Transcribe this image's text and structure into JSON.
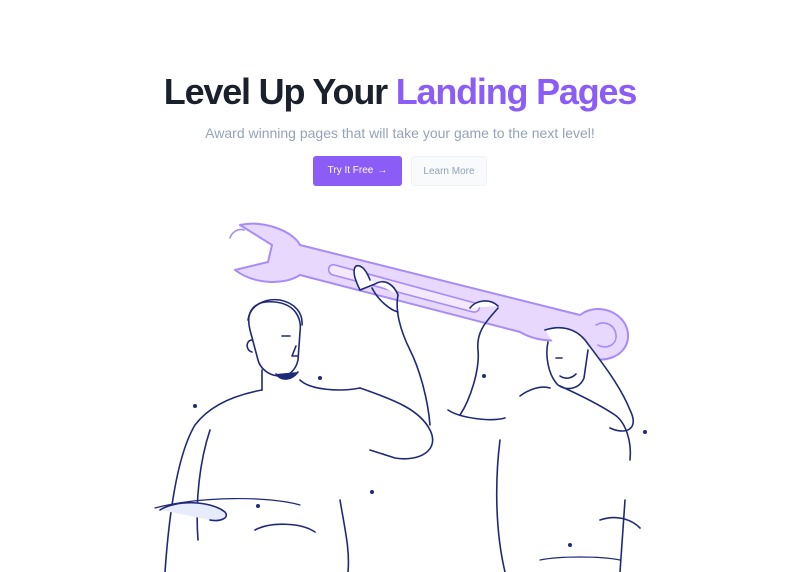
{
  "hero": {
    "title_dark": "Level Up Your ",
    "title_accent": "Landing Pages",
    "subtitle": "Award winning pages that will take your game to the next level!"
  },
  "buttons": {
    "primary_label": "Try It Free",
    "primary_icon": "→",
    "secondary_label": "Learn More"
  },
  "colors": {
    "accent": "#8b5cf6",
    "heading": "#1a202c",
    "muted": "#94a3b8",
    "line_art": "#1e2a78",
    "wrench_fill": "#e9d8fd"
  }
}
